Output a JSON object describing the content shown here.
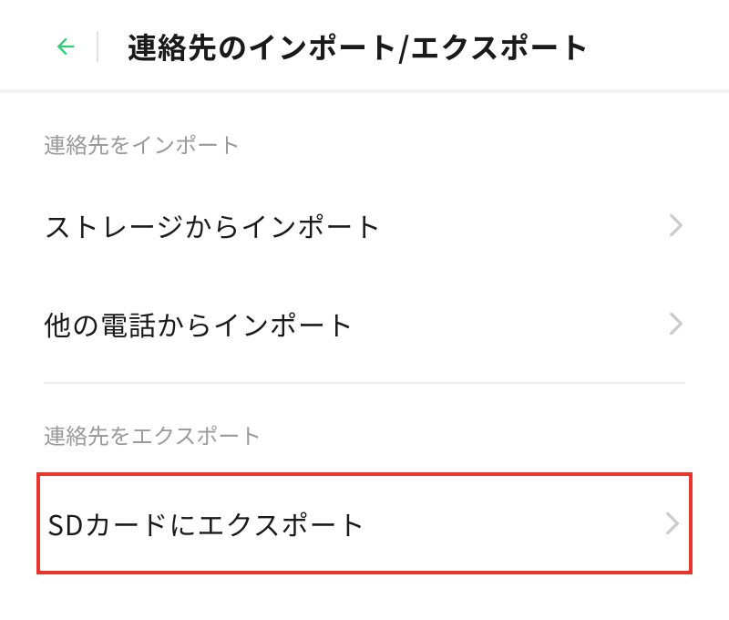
{
  "header": {
    "title": "連絡先のインポート/エクスポート",
    "back_icon_color": "#2ecc71"
  },
  "sections": {
    "import": {
      "header": "連絡先をインポート",
      "items": [
        {
          "label": "ストレージからインポート"
        },
        {
          "label": "他の電話からインポート"
        }
      ]
    },
    "export": {
      "header": "連絡先をエクスポート",
      "items": [
        {
          "label": "SDカードにエクスポート"
        }
      ]
    }
  },
  "colors": {
    "accent_green": "#2ecc71",
    "highlight_red": "#e8362d",
    "chevron_gray": "#cccccc"
  }
}
